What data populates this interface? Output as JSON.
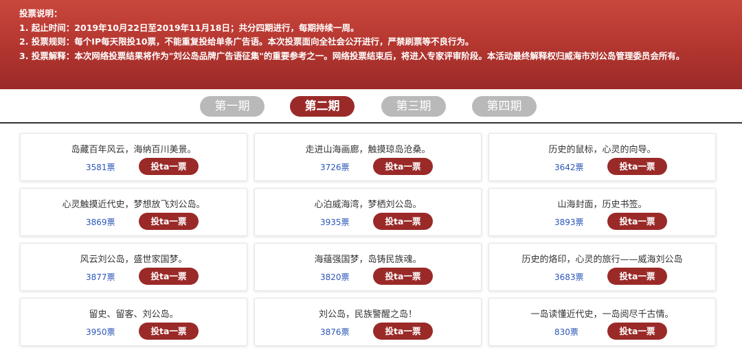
{
  "notice": {
    "title": "投票说明：",
    "line1": "1. 起止时间：2019年10月22日至2019年11月18日；共分四期进行，每期持续一周。",
    "line2": "2. 投票规则：每个IP每天限投10票，不能重复投给单条广告语。本次投票面向全社会公开进行，严禁刷票等不良行为。",
    "line3": "3. 投票解释：本次网络投票结果将作为\"刘公岛品牌广告语征集\"的重要参考之一。网络投票结束后，将进入专家评审阶段。本活动最终解释权归威海市刘公岛管理委员会所有。"
  },
  "tabs": [
    "第一期",
    "第二期",
    "第三期",
    "第四期"
  ],
  "active_tab": "第二期",
  "vote_button_label": "投ta一票",
  "entries": [
    {
      "slogan": "岛藏百年风云，海纳百川美景。",
      "votes": "3581票"
    },
    {
      "slogan": "走进山海画廊，触摸琼岛沧桑。",
      "votes": "3726票"
    },
    {
      "slogan": "历史的鼠标，心灵的向导。",
      "votes": "3642票"
    },
    {
      "slogan": "心灵触摸近代史，梦想放飞刘公岛。",
      "votes": "3869票"
    },
    {
      "slogan": "心泊威海湾，梦栖刘公岛。",
      "votes": "3935票"
    },
    {
      "slogan": "山海封面，历史书签。",
      "votes": "3893票"
    },
    {
      "slogan": "风云刘公岛，盛世家国梦。",
      "votes": "3877票"
    },
    {
      "slogan": "海蕴强国梦，岛铸民族魂。",
      "votes": "3820票"
    },
    {
      "slogan": "历史的烙印，心灵的旅行——威海刘公岛",
      "votes": "3683票"
    },
    {
      "slogan": "留史、留客、刘公岛。",
      "votes": "3950票"
    },
    {
      "slogan": "刘公岛，民族警醒之岛！",
      "votes": "3876票"
    },
    {
      "slogan": "一岛读懂近代史，一岛阅尽千古情。",
      "votes": "830票"
    }
  ],
  "colors": {
    "header": "#b2352f",
    "accent": "#9a2a28",
    "tab_inactive": "#b9b9b9",
    "vote_count": "#2a55b8"
  }
}
